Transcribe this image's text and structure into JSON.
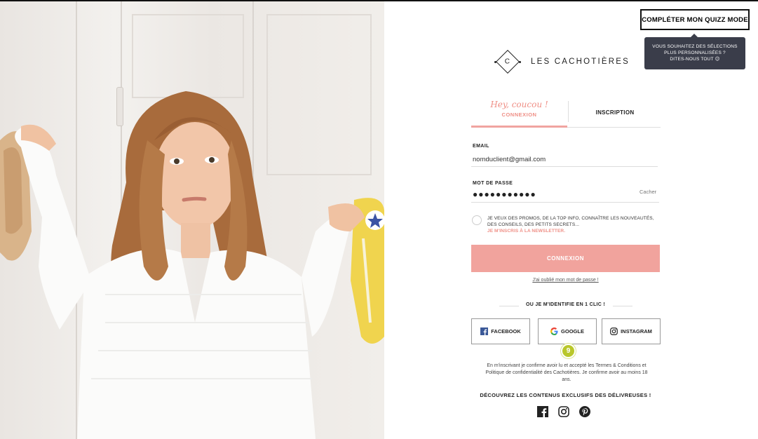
{
  "header": {
    "quiz_button": "COMPLÉTER MON QUIZZ MODE",
    "tooltip_lines": [
      "VOUS SOUHAITEZ DES SÉLECTIONS",
      "PLUS PERSONNALISÉES ?",
      "DITES-NOUS TOUT 😉"
    ]
  },
  "brand": {
    "name": "LES CACHOTIÈRES",
    "monogram": "C"
  },
  "tabs": {
    "login_script": "Hey, coucou !",
    "login_label": "CONNEXION",
    "signup_label": "INSCRIPTION"
  },
  "form": {
    "email_label": "EMAIL",
    "email_value": "nomduclient@gmail.com",
    "password_label": "MOT DE PASSE",
    "password_mask": "●●●●●●●●●●●",
    "hide_label": "Cacher",
    "newsletter_text": "JE VEUX DES PROMOS, DE LA TOP INFO, CONNAÎTRE LES NOUVEAUTÉS, DES CONSEILS, DES PETITS SECRETS...",
    "newsletter_link": "JE M'INSCRIS À LA NEWSLETTER.",
    "submit_label": "CONNEXION",
    "forgot_label": "J'ai oublié mon mot de passe !"
  },
  "social_login": {
    "heading": "OU JE M'IDENTIFIE EN 1 CLIC !",
    "buttons": [
      {
        "label": "FACEBOOK",
        "icon": "facebook-icon"
      },
      {
        "label": "GOOGLE",
        "icon": "google-icon"
      },
      {
        "label": "INSTAGRAM",
        "icon": "instagram-icon"
      }
    ],
    "badge": "9"
  },
  "terms": "En m'inscrivant je confirme avoir lu et accepté les Termes & Conditions et Politique de confidentialité des Cachotières. Je confirme avoir au moins 18 ans.",
  "footer": {
    "discover": "DÉCOUVREZ LES CONTENUS EXCLUSIFS DES DÉLIVREUSES !",
    "icons": [
      "facebook-icon",
      "instagram-icon",
      "pinterest-icon"
    ]
  },
  "colors": {
    "accent": "#f1a39d",
    "accent_text": "#ef8f86",
    "tooltip_bg": "#3a3d4a",
    "badge": "#b9c72a"
  }
}
